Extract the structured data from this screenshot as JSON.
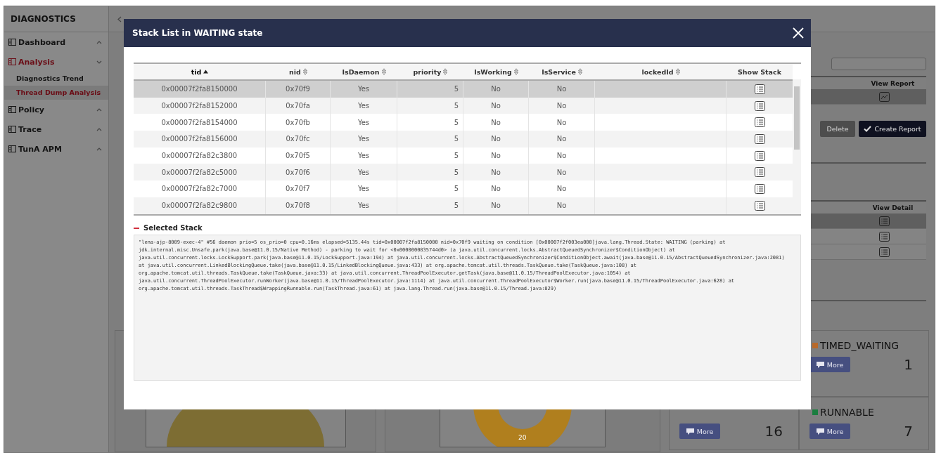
{
  "sidebar": {
    "title": "DIAGNOSTICS",
    "menu": [
      {
        "label": "Dashboard",
        "selected": false,
        "expanded": false
      },
      {
        "label": "Analysis",
        "selected": true,
        "expanded": true,
        "children": [
          {
            "label": "Diagnostics Trend",
            "selected": false
          },
          {
            "label": "Thread Dump Analysis",
            "selected": true
          }
        ]
      },
      {
        "label": "Policy",
        "selected": false,
        "expanded": false
      },
      {
        "label": "Trace",
        "selected": false,
        "expanded": false
      },
      {
        "label": "TunA APM",
        "selected": false,
        "expanded": false
      }
    ]
  },
  "report_table": {
    "header": "View Report",
    "rows": [
      {
        "selected": true
      }
    ]
  },
  "actions": {
    "delete": "Delete",
    "create": "Create Report"
  },
  "detail_table": {
    "header": "View Detail",
    "rows": [
      {
        "selected": true
      },
      {
        "selected": false
      },
      {
        "selected": false
      }
    ]
  },
  "donut_label": "20",
  "status_cards": [
    {
      "label": "TIMED_WAITING",
      "color": "#b8692a",
      "count": "1",
      "more": "More"
    },
    {
      "count": "16",
      "more": "More"
    },
    {
      "label": "RUNNABLE",
      "color": "#1a7d3f",
      "count": "7",
      "more": "More"
    }
  ],
  "modal": {
    "title": "Stack List in WAITING state",
    "columns": [
      {
        "label": "tid",
        "sortable": true,
        "sorted": true
      },
      {
        "label": "nid",
        "sortable": true,
        "sorted": false
      },
      {
        "label": "IsDaemon",
        "sortable": true,
        "sorted": false
      },
      {
        "label": "priority",
        "sortable": true,
        "sorted": false
      },
      {
        "label": "IsWorking",
        "sortable": true,
        "sorted": false
      },
      {
        "label": "IsService",
        "sortable": true,
        "sorted": false
      },
      {
        "label": "lockedId",
        "sortable": true,
        "sorted": false
      },
      {
        "label": "Show Stack",
        "sortable": false,
        "sorted": false
      }
    ],
    "rows": [
      {
        "tid": "0x00007f2fa8150000",
        "nid": "0x70f9",
        "daemon": "Yes",
        "priority": "5",
        "working": "No",
        "service": "No",
        "selected": true
      },
      {
        "tid": "0x00007f2fa8152000",
        "nid": "0x70fa",
        "daemon": "Yes",
        "priority": "5",
        "working": "No",
        "service": "No",
        "selected": false
      },
      {
        "tid": "0x00007f2fa8154000",
        "nid": "0x70fb",
        "daemon": "Yes",
        "priority": "5",
        "working": "No",
        "service": "No",
        "selected": false
      },
      {
        "tid": "0x00007f2fa8156000",
        "nid": "0x70fc",
        "daemon": "Yes",
        "priority": "5",
        "working": "No",
        "service": "No",
        "selected": false
      },
      {
        "tid": "0x00007f2fa82c3800",
        "nid": "0x70f5",
        "daemon": "Yes",
        "priority": "5",
        "working": "No",
        "service": "No",
        "selected": false
      },
      {
        "tid": "0x00007f2fa82c5000",
        "nid": "0x70f6",
        "daemon": "Yes",
        "priority": "5",
        "working": "No",
        "service": "No",
        "selected": false
      },
      {
        "tid": "0x00007f2fa82c7000",
        "nid": "0x70f7",
        "daemon": "Yes",
        "priority": "5",
        "working": "No",
        "service": "No",
        "selected": false
      },
      {
        "tid": "0x00007f2fa82c9800",
        "nid": "0x70f8",
        "daemon": "Yes",
        "priority": "5",
        "working": "No",
        "service": "No",
        "selected": false
      }
    ],
    "stack_title": "Selected Stack",
    "stack_text": "\"lena-ajp-8009-exec-4\" #56 daemon prio=5 os_prio=0 cpu=0.16ms elapsed=5135.44s tid=0x00007f2fa8150000 nid=0x70f9 waiting on condition [0x00007f2f003ea000]java.lang.Thread.State: WAITING (parking) at jdk.internal.misc.Unsafe.park(java.base@11.0.15/Native Method) - parking to wait for <0x0000000835744d0> (a java.util.concurrent.locks.AbstractQueuedSynchronizer$ConditionObject) at java.util.concurrent.locks.LockSupport.park(java.base@11.0.15/LockSupport.java:194) at java.util.concurrent.locks.AbstractQueuedSynchronizer$ConditionObject.await(java.base@11.0.15/AbstractQueuedSynchronizer.java:2081) at java.util.concurrent.LinkedBlockingQueue.take(java.base@11.0.15/LinkedBlockingQueue.java:433) at org.apache.tomcat.util.threads.TaskQueue.take(TaskQueue.java:108) at org.apache.tomcat.util.threads.TaskQueue.take(TaskQueue.java:33) at java.util.concurrent.ThreadPoolExecutor.getTask(java.base@11.0.15/ThreadPoolExecutor.java:1054) at java.util.concurrent.ThreadPoolExecutor.runWorker(java.base@11.0.15/ThreadPoolExecutor.java:1114) at java.util.concurrent.ThreadPoolExecutor$Worker.run(java.base@11.0.15/ThreadPoolExecutor.java:628) at org.apache.tomcat.util.threads.TaskThread$WrappingRunnable.run(TaskThread.java:61) at java.lang.Thread.run(java.base@11.0.15/Thread.java:829)"
  }
}
